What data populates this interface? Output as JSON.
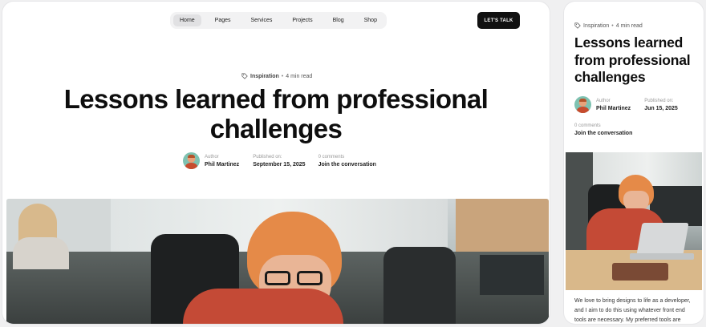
{
  "nav": {
    "items": [
      {
        "label": "Home",
        "active": true
      },
      {
        "label": "Pages"
      },
      {
        "label": "Services"
      },
      {
        "label": "Projects"
      },
      {
        "label": "Blog"
      },
      {
        "label": "Shop"
      }
    ],
    "cta_label": "LET'S TALK"
  },
  "post": {
    "category": "Inspiration",
    "read_time": "4 min read",
    "separator": "•",
    "title": "Lessons learned from professional challenges",
    "author_label": "Author",
    "author_name": "Phil Martinez",
    "published_label": "Published on:",
    "published_date": "September 15, 2025",
    "comments_label": "0 comments",
    "comments_link": "Join the conversation"
  },
  "mobile": {
    "published_date": "Jun 15, 2025",
    "body_text": "We love to bring designs to life as a developer, and I aim to do this using whatever front end tools are necessary. My preferred tools are"
  },
  "icons": {
    "tag": "tag-icon",
    "avatar": "author-avatar"
  },
  "colors": {
    "cta_bg": "#111111",
    "nav_bg": "#f2f2f3",
    "nav_active": "#e1e1e3",
    "hair": "#e98d4e",
    "sweater": "#c44a36"
  }
}
